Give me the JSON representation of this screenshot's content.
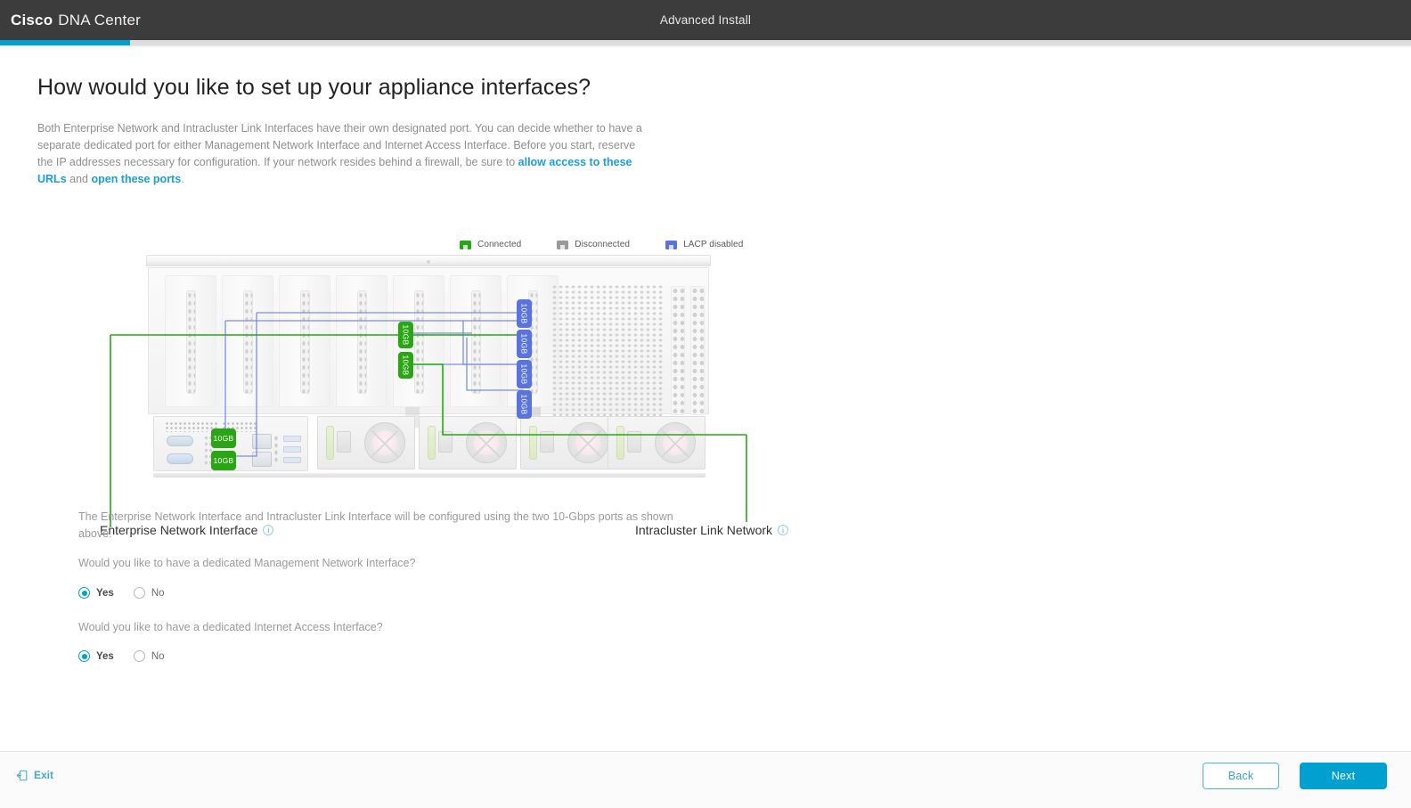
{
  "header": {
    "brand_bold": "Cisco",
    "brand_rest": "DNA Center",
    "title": "Advanced Install",
    "progress_percent": 9.2,
    "accent_color": "#00a0d1",
    "bar_color": "#3c3c3c"
  },
  "main": {
    "page_title": "How would you like to set up your appliance interfaces?",
    "intro_part1": "Both Enterprise Network and Intracluster Link Interfaces have their own designated port. You can decide whether to have a separate dedicated port for either Management Network Interface and Internet Access Interface. Before you start, reserve the IP addresses necessary for configuration. If your network resides behind a firewall, be sure to ",
    "intro_link1": "allow access to these URLs",
    "intro_mid": " and ",
    "intro_link2": "open these ports",
    "intro_end": "."
  },
  "legend": {
    "items": [
      {
        "label": "Connected",
        "color": "#2aa615"
      },
      {
        "label": "Disconnected",
        "color": "#9a9a9a"
      },
      {
        "label": "LACP disabled",
        "color": "#5b74dd"
      }
    ]
  },
  "diagram": {
    "chip_label": "10GB",
    "green_chips": 4,
    "blue_chips": 4,
    "enterprise_label": "Enterprise Network Interface",
    "intracluster_label": "Intracluster Link Network",
    "info_glyph": "i",
    "green_line_color": "#2aa615",
    "blue_line_color": "#7b8fe0",
    "psu_count": 4
  },
  "form": {
    "note": "The Enterprise Network Interface and Intracluster Link Interface will be configured using the two 10-Gbps ports as shown above.",
    "question_management": "Would you like to have a dedicated Management Network Interface?",
    "question_internet": "Would you like to have a dedicated Internet Access Interface?",
    "yes_label": "Yes",
    "no_label": "No",
    "management_selected": "Yes",
    "internet_selected": "Yes"
  },
  "footer": {
    "exit_label": "Exit",
    "back_label": "Back",
    "next_label": "Next"
  }
}
